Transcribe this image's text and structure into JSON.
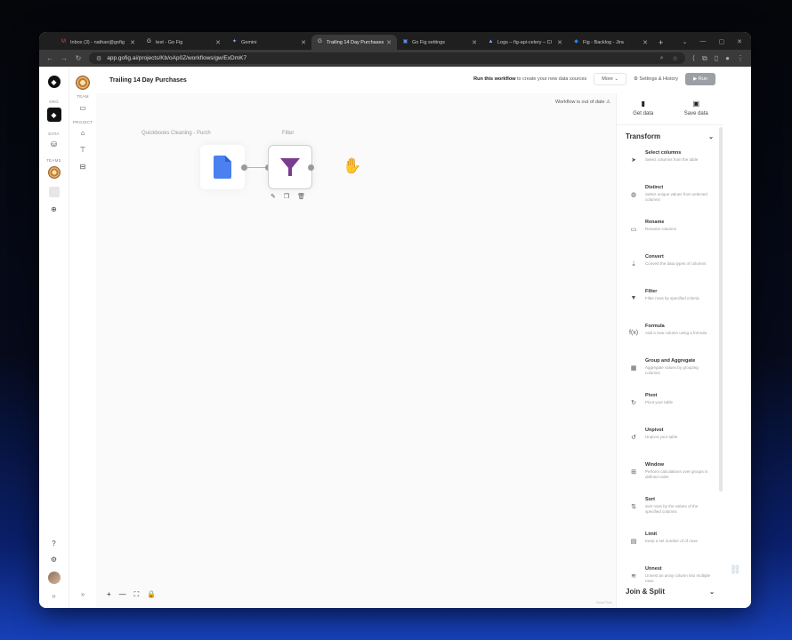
{
  "browser": {
    "tabs": [
      {
        "title": "Inbox (3) - nathan@gofig",
        "fav": "M",
        "favcolor": "#ea4335"
      },
      {
        "title": "test - Go Fig",
        "fav": "G",
        "favcolor": "#dddddd"
      },
      {
        "title": "Gemini",
        "fav": "✦",
        "favcolor": "#8ab4f8"
      },
      {
        "title": "Trailing 14 Day Purchases",
        "fav": "G",
        "favcolor": "#dddddd",
        "active": true
      },
      {
        "title": "Go Fig settings",
        "fav": "▣",
        "favcolor": "#5b8def"
      },
      {
        "title": "Logs – fig-api-celery – Cl",
        "fav": "▲",
        "favcolor": "#8ab4f8"
      },
      {
        "title": "Fig - Backlog - Jira",
        "fav": "◆",
        "favcolor": "#2684ff"
      }
    ],
    "new_tab": "+",
    "url": "app.gofig.ai/projects/Kb/oAp0Z/workflows/gw/ExDmK7"
  },
  "rail": {
    "org_label": "ORG",
    "data_label": "DATA",
    "teams_label": "TEAMS",
    "team_label": "TEAM",
    "project_label": "PROJECT",
    "expand": "»"
  },
  "header": {
    "title": "Trailing 14 Day Purchases",
    "run_hint_bold": "Run this workflow",
    "run_hint_rest": " to create your new data sources",
    "more_label": "More",
    "settings_label": "Settings & History",
    "run_label": "Run"
  },
  "canvas": {
    "status": "Workflow is out of date",
    "nodes": [
      {
        "title": "Quickbooks Cleaning - Purch",
        "icon": "document-icon"
      },
      {
        "title": "Filter",
        "icon": "funnel-icon"
      }
    ],
    "controls": {
      "zoom_in": "+",
      "zoom_out": "—",
      "fit": "⛶",
      "lock": "🔒"
    },
    "powered": "React Flow"
  },
  "panel": {
    "get_data": "Get data",
    "save_data": "Save data",
    "transform_label": "Transform",
    "join_label": "Join & Split",
    "transforms": [
      {
        "name": "Select columns",
        "desc": "Select columns from the table",
        "icon": "➤"
      },
      {
        "name": "Distinct",
        "desc": "Select unique values from selected columns",
        "icon": "◍"
      },
      {
        "name": "Rename",
        "desc": "Rename columns",
        "icon": "▭"
      },
      {
        "name": "Convert",
        "desc": "Convert the data types of columns",
        "icon": "⇣"
      },
      {
        "name": "Filter",
        "desc": "Filter rows by specified criteria",
        "icon": "▼"
      },
      {
        "name": "Formula",
        "desc": "Add a new column using a formula",
        "icon": "f(x)"
      },
      {
        "name": "Group and Aggregate",
        "desc": "Aggregate values by grouping columns",
        "icon": "▦"
      },
      {
        "name": "Pivot",
        "desc": "Pivot your table",
        "icon": "↻"
      },
      {
        "name": "Unpivot",
        "desc": "Unpivot your table",
        "icon": "↺"
      },
      {
        "name": "Window",
        "desc": "Perform calculations over groups in defined order",
        "icon": "⊞"
      },
      {
        "name": "Sort",
        "desc": "Sort rows by the values of the specified columns",
        "icon": "⇅"
      },
      {
        "name": "Limit",
        "desc": "Keep a set number of of rows",
        "icon": "▤"
      },
      {
        "name": "Unnest",
        "desc": "Unnest an array column into multiple rows",
        "icon": "≋"
      }
    ]
  }
}
